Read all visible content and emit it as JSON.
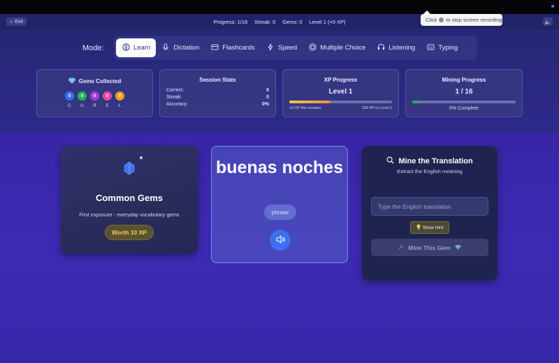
{
  "hud": {
    "exit_label": "Exit",
    "progress": "Progress: 1/16",
    "streak": "Streak: 0",
    "gems": "Gems: 0",
    "level": "Level 1 (+0 XP)"
  },
  "tooltip": {
    "before": "Click",
    "after": "to stop screen recording"
  },
  "modes": {
    "label": "Mode:",
    "items": [
      {
        "label": "Learn",
        "icon": "brain-icon",
        "active": true
      },
      {
        "label": "Dictation",
        "icon": "microphone-icon",
        "active": false
      },
      {
        "label": "Flashcards",
        "icon": "card-icon",
        "active": false
      },
      {
        "label": "Speed",
        "icon": "lightning-icon",
        "active": false
      },
      {
        "label": "Multiple Choice",
        "icon": "target-icon",
        "active": false
      },
      {
        "label": "Listening",
        "icon": "headphones-icon",
        "active": false
      },
      {
        "label": "Typing",
        "icon": "keyboard-icon",
        "active": false
      }
    ]
  },
  "gems_panel": {
    "title": "Gems Collected",
    "gems": [
      {
        "count": "0",
        "letter": "C",
        "color": "#3b6ff0"
      },
      {
        "count": "0",
        "letter": "U",
        "color": "#22b55c"
      },
      {
        "count": "0",
        "letter": "R",
        "color": "#9b3fe0"
      },
      {
        "count": "0",
        "letter": "E",
        "color": "#e64aa0"
      },
      {
        "count": "0",
        "letter": "L",
        "color": "#e8a21e"
      }
    ]
  },
  "session_stats": {
    "title": "Session Stats",
    "correct_label": "Correct:",
    "correct_value": "0",
    "streak_label": "Streak:",
    "streak_value": "0",
    "accuracy_label": "Accuracy:",
    "accuracy_value": "0%"
  },
  "xp_progress": {
    "title": "XP Progress",
    "level": "Level 1",
    "fill_fraction": 0.4,
    "left_note": "+0 XP this session",
    "right_note": "100 XP to Level 2"
  },
  "mining_progress": {
    "title": "Mining Progress",
    "count": "1 / 16",
    "fill_fraction": 0.06,
    "complete": "6% Complete"
  },
  "gem_card": {
    "title": "Common Gems",
    "description": "First exposure - everyday vocabulary gems",
    "worth": "Worth 10 XP"
  },
  "word_card": {
    "word": "buenas noches",
    "tag": "phrase"
  },
  "mine_card": {
    "title": "Mine the Translation",
    "subtitle": "Extract the English meaning",
    "placeholder": "Type the English translation",
    "hint_label": "Show Hint",
    "submit_label": "Mine This Gem"
  },
  "colors": {
    "accent": "#3b6ff0",
    "gold": "#f4cf57",
    "progress_green": "#22b55c"
  }
}
